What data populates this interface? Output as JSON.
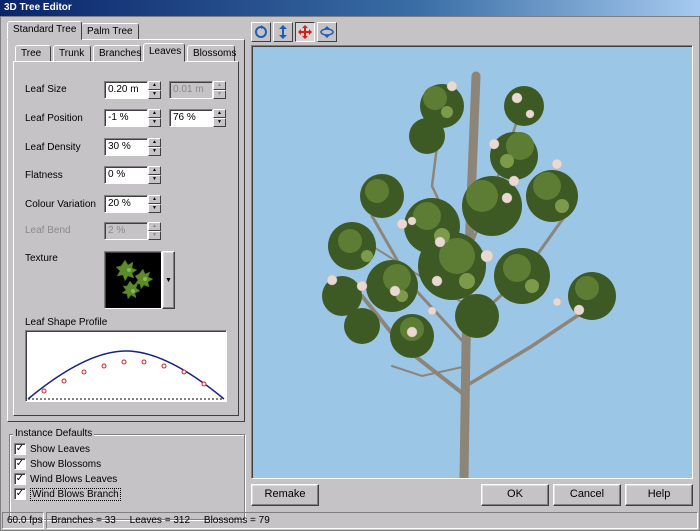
{
  "window": {
    "title": "3D Tree Editor"
  },
  "outer_tabs": [
    {
      "label": "Standard Tree",
      "active": true
    },
    {
      "label": "Palm Tree",
      "active": false
    }
  ],
  "inner_tabs": [
    {
      "label": "Tree"
    },
    {
      "label": "Trunk"
    },
    {
      "label": "Branches"
    },
    {
      "label": "Leaves",
      "active": true
    },
    {
      "label": "Blossoms"
    }
  ],
  "leaves": {
    "leaf_size": {
      "label": "Leaf Size",
      "value": "0.20 m",
      "variation": "0.01 m"
    },
    "leaf_position": {
      "label": "Leaf Position",
      "value": "-1 %",
      "variation": "76 %"
    },
    "leaf_density": {
      "label": "Leaf Density",
      "value": "30 %"
    },
    "flatness": {
      "label": "Flatness",
      "value": "0 %"
    },
    "colour_variation": {
      "label": "Colour Variation",
      "value": "20 %"
    },
    "leaf_bend": {
      "label": "Leaf Bend",
      "value": "2 %"
    },
    "texture": {
      "label": "Texture"
    },
    "shape_profile": {
      "label": "Leaf Shape Profile"
    }
  },
  "instance_defaults": {
    "title": "Instance Defaults",
    "items": [
      {
        "label": "Show Leaves",
        "checked": true
      },
      {
        "label": "Show Blossoms",
        "checked": true
      },
      {
        "label": "Wind Blows Leaves",
        "checked": true
      },
      {
        "label": "Wind Blows Branch",
        "checked": true
      }
    ]
  },
  "toolbar": {
    "tools": [
      {
        "icon": "rotate-icon"
      },
      {
        "icon": "move-vertical-icon"
      },
      {
        "icon": "move-icon",
        "pressed": true
      },
      {
        "icon": "orbit-icon"
      }
    ]
  },
  "buttons": {
    "remake": "Remake",
    "ok": "OK",
    "cancel": "Cancel",
    "help": "Help"
  },
  "status": {
    "fps": "60.0 fps",
    "branches": "Branches = 33",
    "leaves": "Leaves = 312",
    "blossoms": "Blossoms = 79"
  },
  "colors": {
    "sky": "#9cc6e6",
    "accent_icon": "#1e5fb4",
    "active_tool": "#d22020"
  }
}
